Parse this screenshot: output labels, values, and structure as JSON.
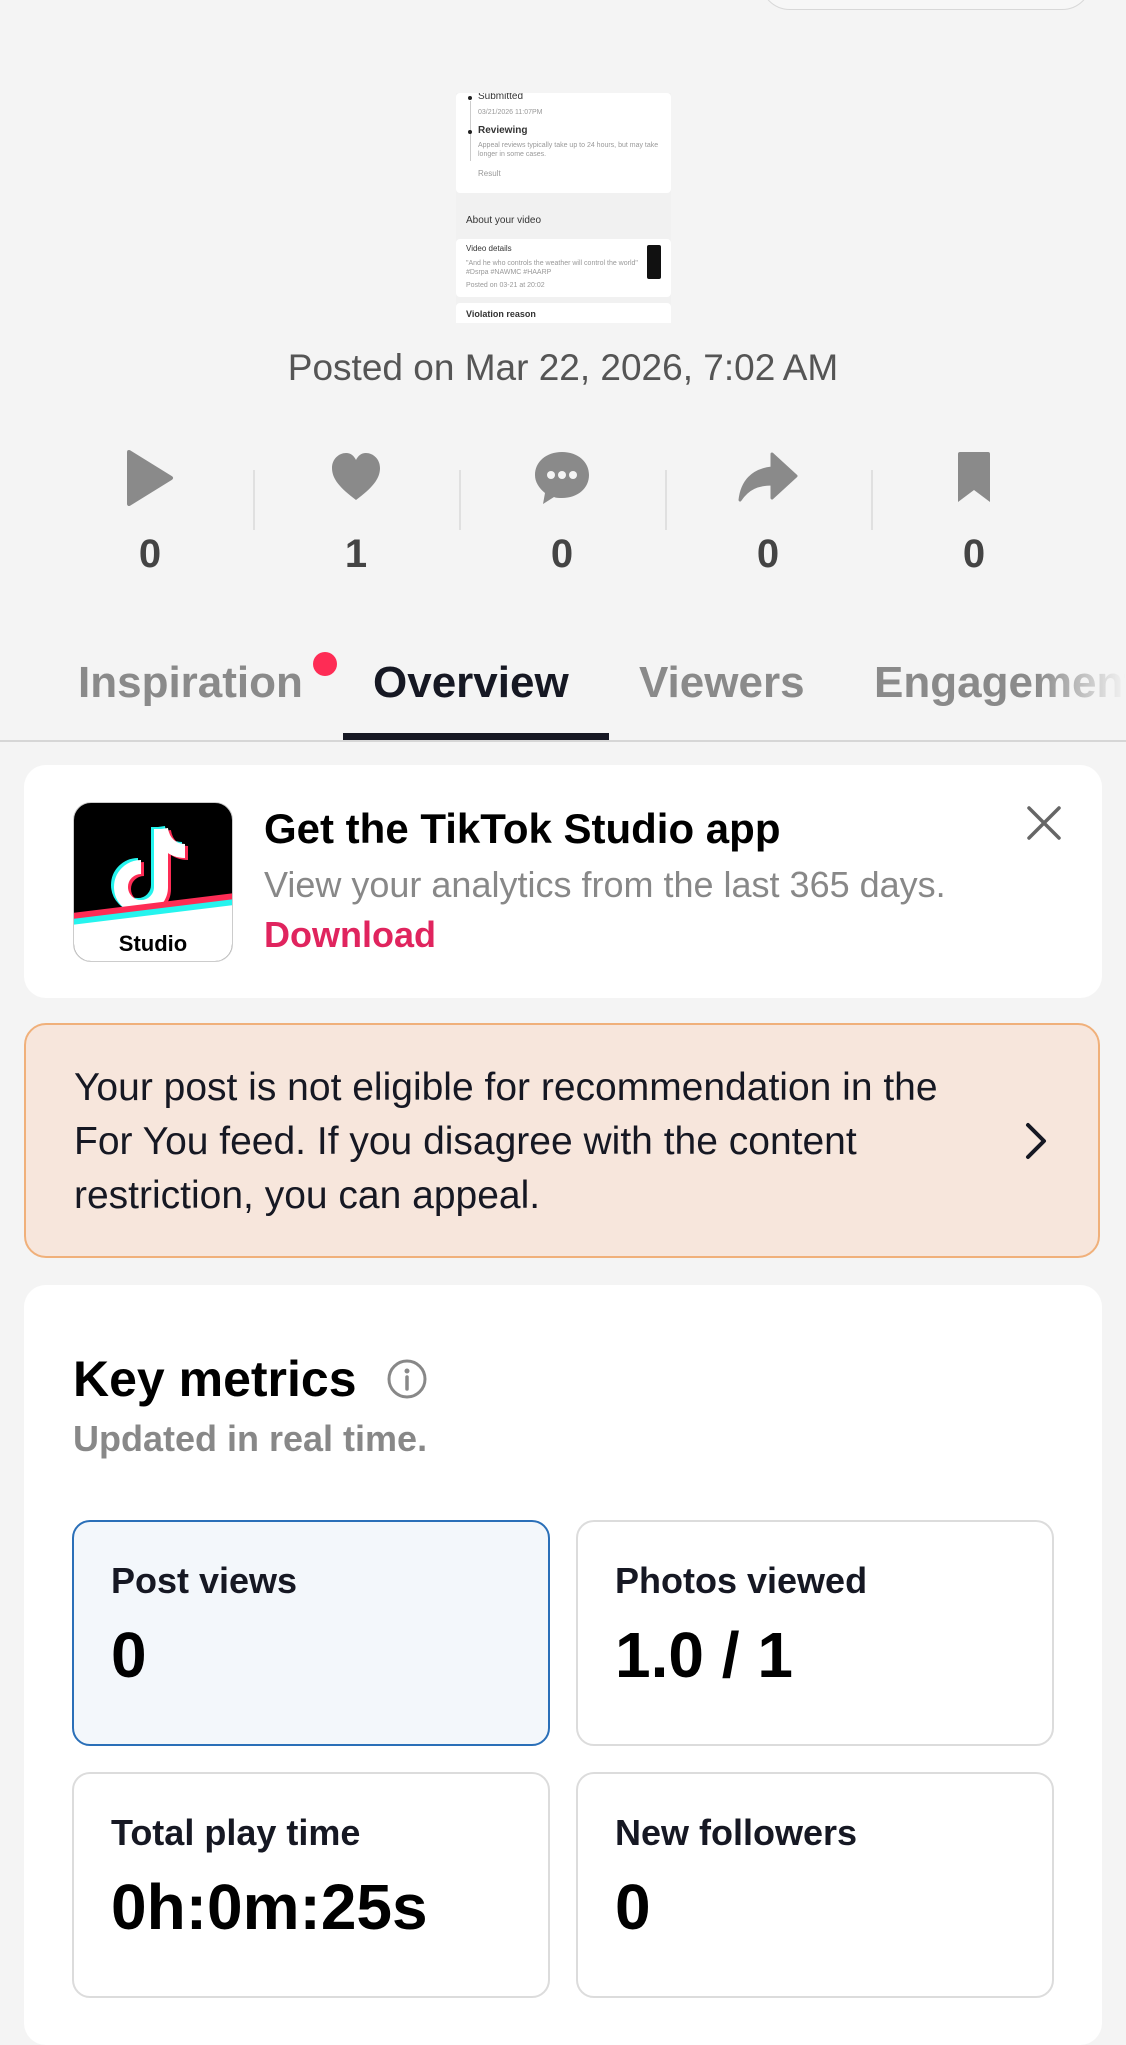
{
  "thumbnail": {
    "step1_title": "Submitted",
    "step1_time": "03/21/2026 11:07PM",
    "step2_title": "Reviewing",
    "step2_desc": "Appeal reviews typically take up to 24 hours, but may take longer in some cases.",
    "step3_title": "Result",
    "about_heading": "About your video",
    "details_title": "Video details",
    "details_text": "\"And he who controls the weather will control the world\" #Dsrpa #NAWMC #HAARP",
    "details_posted": "Posted on 03-21 at 20:02",
    "violation_title": "Violation reason"
  },
  "posted_on": "Posted on Mar 22, 2026, 7:02 AM",
  "stats": [
    {
      "icon": "play-icon",
      "value": "0"
    },
    {
      "icon": "heart-icon",
      "value": "1"
    },
    {
      "icon": "comment-icon",
      "value": "0"
    },
    {
      "icon": "share-icon",
      "value": "0"
    },
    {
      "icon": "bookmark-icon",
      "value": "0"
    }
  ],
  "tabs": [
    {
      "label": "Inspiration",
      "active": false,
      "has_dot": true
    },
    {
      "label": "Overview",
      "active": true
    },
    {
      "label": "Viewers",
      "active": false
    },
    {
      "label": "Engagement",
      "active": false
    }
  ],
  "promo": {
    "icon_label": "Studio",
    "title": "Get the TikTok Studio app",
    "description": "View your analytics from the last 365 days.",
    "link": "Download"
  },
  "warning": {
    "text": "Your post is not eligible for recommendation in the For You feed. If you disagree with the content restriction, you can appeal."
  },
  "metrics": {
    "title": "Key metrics",
    "subtitle": "Updated in real time.",
    "cards": [
      {
        "label": "Post views",
        "value": "0",
        "selected": true
      },
      {
        "label": "Photos viewed",
        "value": "1.0 / 1",
        "selected": false
      },
      {
        "label": "Total play time",
        "value": "0h:0m:25s",
        "selected": false
      },
      {
        "label": "New followers",
        "value": "0",
        "selected": false
      }
    ]
  },
  "colors": {
    "accent_red": "#fe2c55",
    "link_red": "#e0245e",
    "selected_border": "#2a6fb8",
    "warning_bg": "#f7e6dc",
    "warning_border": "#f0b07a"
  }
}
